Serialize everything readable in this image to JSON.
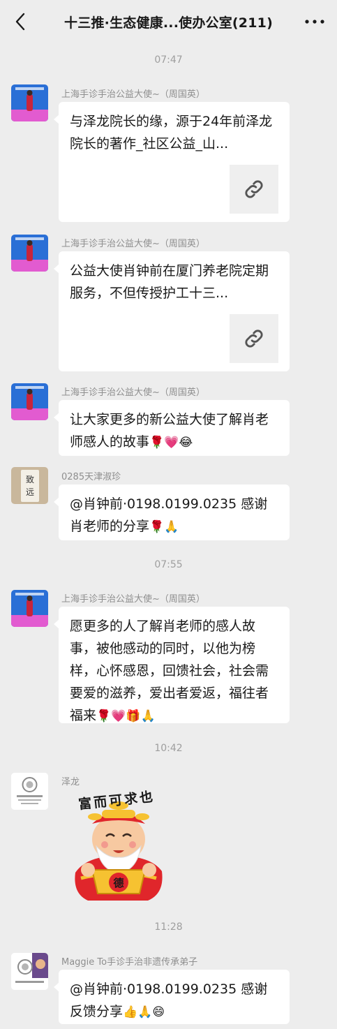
{
  "header": {
    "title": "十三推·生态健康...使办公室(211)"
  },
  "timestamps": [
    "07:47",
    "07:55",
    "10:42",
    "11:28"
  ],
  "messages": [
    {
      "sender": "上海手诊手治公益大使~（周国英）",
      "text": "与泽龙院长的缘，源于24年前泽龙院长的著作_社区公益_山...",
      "type": "link"
    },
    {
      "sender": "上海手诊手治公益大使~（周国英）",
      "text": "公益大使肖钟前在厦门养老院定期服务，不但传授护工十三...",
      "type": "link"
    },
    {
      "sender": "上海手诊手治公益大使~（周国英）",
      "text": "让大家更多的新公益大使了解肖老师感人的故事",
      "emojis": "🌹💗😂",
      "type": "text"
    },
    {
      "sender": "0285天津淑珍",
      "text": "@肖钟前·0198.0199.0235  感谢肖老师的分享",
      "emojis": "🌹🙏",
      "type": "text"
    },
    {
      "sender": "上海手诊手治公益大使~（周国英）",
      "text": "愿更多的人了解肖老师的感人故事，被他感动的同时，以他为榜样，心怀感恩，回馈社会，社会需要爱的滋养，爱出者爱返，福往者福来",
      "emojis": "🌹💗🎁🙏",
      "type": "text"
    },
    {
      "sender": "泽龙",
      "sticker_text": "富而可求也",
      "sticker_badge": "德",
      "type": "sticker"
    },
    {
      "sender": "Maggie To手诊手治非遗传承弟子",
      "text": "@肖钟前·0198.0199.0235  感谢反馈分享",
      "emojis": "👍🙏😄",
      "type": "text"
    }
  ],
  "colors": {
    "background": "#ededed",
    "bubble": "#ffffff",
    "timestamp": "#9e9e9e",
    "sender": "#8e8e8e"
  },
  "icons": {
    "back": "chevron-left-icon",
    "more": "more-dots-icon",
    "link": "link-icon"
  }
}
